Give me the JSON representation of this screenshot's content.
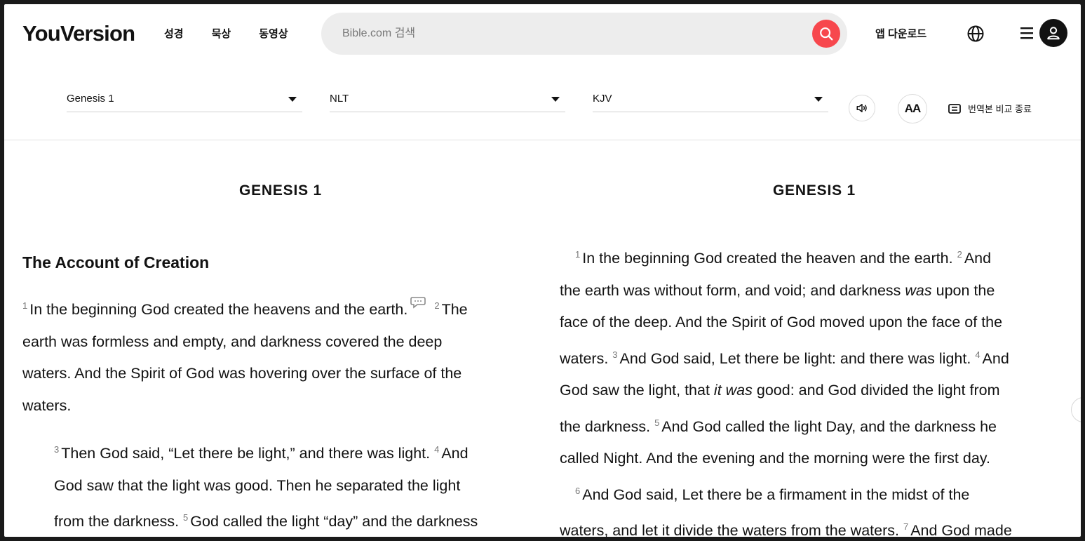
{
  "nav": {
    "logo": "YouVersion",
    "links": [
      "성경",
      "묵상",
      "동영상"
    ],
    "search_placeholder": "Bible.com 검색",
    "app_download": "앱 다운로드",
    "icons": [
      "search-icon",
      "globe-icon",
      "menu-icon",
      "user-icon"
    ],
    "accent_color": "#f7474d"
  },
  "selectors": {
    "book_chapter": "Genesis 1",
    "version_left": "NLT",
    "version_right": "KJV",
    "font_size_label": "AA",
    "compare_exit": "번역본 비교 종료"
  },
  "left": {
    "chapter_title": "GENESIS 1",
    "section_heading": "The Account of Creation",
    "p1": {
      "v1": "1",
      "t1": "In the beginning God created the heavens and the earth.",
      "v2": "2",
      "t2a": "The",
      "t2b": "earth was formless and empty, and darkness covered the deep",
      "t2c": "waters. And the Spirit of God was hovering over the surface of the",
      "t2d": "waters."
    },
    "p2": {
      "v3": "3",
      "t3": "Then God said, “Let there be light,” and there was light.",
      "v4": "4",
      "t4a": "And",
      "t4b": "God saw that the light was good. Then he separated the light",
      "t4c": "from the darkness.",
      "v5": "5",
      "t5": "God called the light “day” and the darkness"
    }
  },
  "right": {
    "chapter_title": "GENESIS 1",
    "v1": "1",
    "l1": "In the beginning God created the heaven and the earth.",
    "v2": "2",
    "l1b": "And",
    "l2a": "the earth was without form, and void; and darkness",
    "l2i": "was",
    "l2b": "upon the",
    "l3": "face of the deep. And the Spirit of God moved upon the face of the",
    "l4a": "waters.",
    "v3": "3",
    "l4b": "And God said, Let there be light: and there was light.",
    "v4": "4",
    "l4c": "And",
    "l5a": "God saw the light, that",
    "l5i": "it was",
    "l5b": "good: and God divided the light from",
    "l6a": "the darkness.",
    "v5": "5",
    "l6b": "And God called the light Day, and the darkness he",
    "l7": "called Night. And the evening and the morning were the first day.",
    "v6": "6",
    "l8": "And God said, Let there be a firmament in the midst of the",
    "l9a": "waters, and let it divide the waters from the waters.",
    "v7": "7",
    "l9b": "And God made"
  }
}
